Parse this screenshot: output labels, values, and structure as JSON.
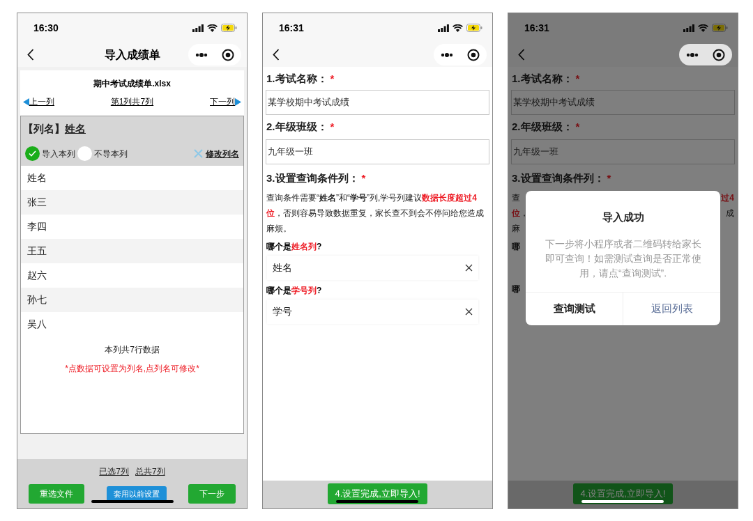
{
  "screens": [
    {
      "kind": "column_import",
      "time": "16:30",
      "title": "导入成绩单",
      "file_name": "期中考试成绩单.xlsx",
      "prev": "上一列",
      "position": "第1列共7列",
      "next": "下一列",
      "column_label": "【列名】",
      "column_name": "姓名",
      "options": [
        {
          "label": "导入本列",
          "selected": true
        },
        {
          "label": "不导本列",
          "selected": false
        }
      ],
      "rename": "修改列名",
      "rows": [
        "姓名",
        "张三",
        "李四",
        "王五",
        "赵六",
        "孙七",
        "吴八"
      ],
      "row_count": "本列共7行数据",
      "hint": "*点数据可设置为列名,点列名可修改*",
      "selected_count": "已选7列",
      "total_count": "总共7列",
      "buttons": [
        {
          "label": "重选文件",
          "kind": "primary"
        },
        {
          "label": "套用以前设置",
          "kind": "secondary"
        },
        {
          "label": "下一步",
          "kind": "primary"
        }
      ]
    },
    {
      "kind": "settings",
      "time": "16:31",
      "fields": [
        {
          "label": "1.考试名称：",
          "mark": "*",
          "value": "某学校期中考试成绩"
        },
        {
          "label": "2.年级班级：",
          "mark": "*",
          "value": "九年级一班"
        }
      ],
      "section": {
        "label": "3.设置查询条件列：",
        "mark": "*"
      },
      "note": [
        {
          "text": "查询条件需要“",
          "kind": "normal"
        },
        {
          "text": "姓名",
          "kind": "bold"
        },
        {
          "text": "”和“",
          "kind": "normal"
        },
        {
          "text": "学号",
          "kind": "bold"
        },
        {
          "text": "”列,学号列建议",
          "kind": "normal"
        },
        {
          "text": "数据长度超过4位",
          "kind": "red"
        },
        {
          "text": "，否则容易导致数据重复，家长查不到会不停问给您造成麻烦。",
          "kind": "normal"
        }
      ],
      "pickers": [
        {
          "question": [
            {
              "text": "哪个是",
              "kind": "bold"
            },
            {
              "text": "姓名列",
              "kind": "red"
            },
            {
              "text": "?",
              "kind": "bold"
            }
          ],
          "value": "姓名"
        },
        {
          "question": [
            {
              "text": "哪个是",
              "kind": "bold"
            },
            {
              "text": "学号列",
              "kind": "red"
            },
            {
              "text": "?",
              "kind": "bold"
            }
          ],
          "value": "学号"
        }
      ],
      "submit": "4.设置完成,立即导入!"
    },
    {
      "kind": "success_dialog",
      "time": "16:31",
      "fields": [
        {
          "label": "1.考试名称：",
          "mark": "*",
          "value": "某学校期中考试成绩"
        },
        {
          "label": "2.年级班级：",
          "mark": "*",
          "value": "九年级一班"
        }
      ],
      "section": {
        "label": "3.设置查询条件列：",
        "mark": "*"
      },
      "covered_lines": [
        {
          "kind": "note",
          "left": [
            {
              "text": "查",
              "kind": "normal"
            }
          ],
          "right": [
            {
              "text": "过4",
              "kind": "red"
            }
          ]
        },
        {
          "kind": "note",
          "left": [
            {
              "text": "位",
              "kind": "red"
            },
            {
              "text": "，",
              "kind": "normal"
            }
          ],
          "right": [
            {
              "text": "成",
              "kind": "normal"
            }
          ]
        },
        {
          "kind": "note",
          "left": [
            {
              "text": "麻",
              "kind": "normal"
            }
          ]
        },
        {
          "kind": "question",
          "left": [
            {
              "text": "哪",
              "kind": "bold"
            }
          ]
        },
        {
          "kind": "question",
          "left": [
            {
              "text": "哪",
              "kind": "bold"
            }
          ]
        }
      ],
      "dialog": {
        "title": "导入成功",
        "message": "下一步将小程序或者二维码转给家长即可查询！如需测试查询是否正常使用，请点“查询测试”.",
        "actions": [
          {
            "label": "查询测试",
            "kind": "default"
          },
          {
            "label": "返回列表",
            "kind": "link"
          }
        ]
      },
      "submit": "4.设置完成,立即导入!"
    }
  ]
}
